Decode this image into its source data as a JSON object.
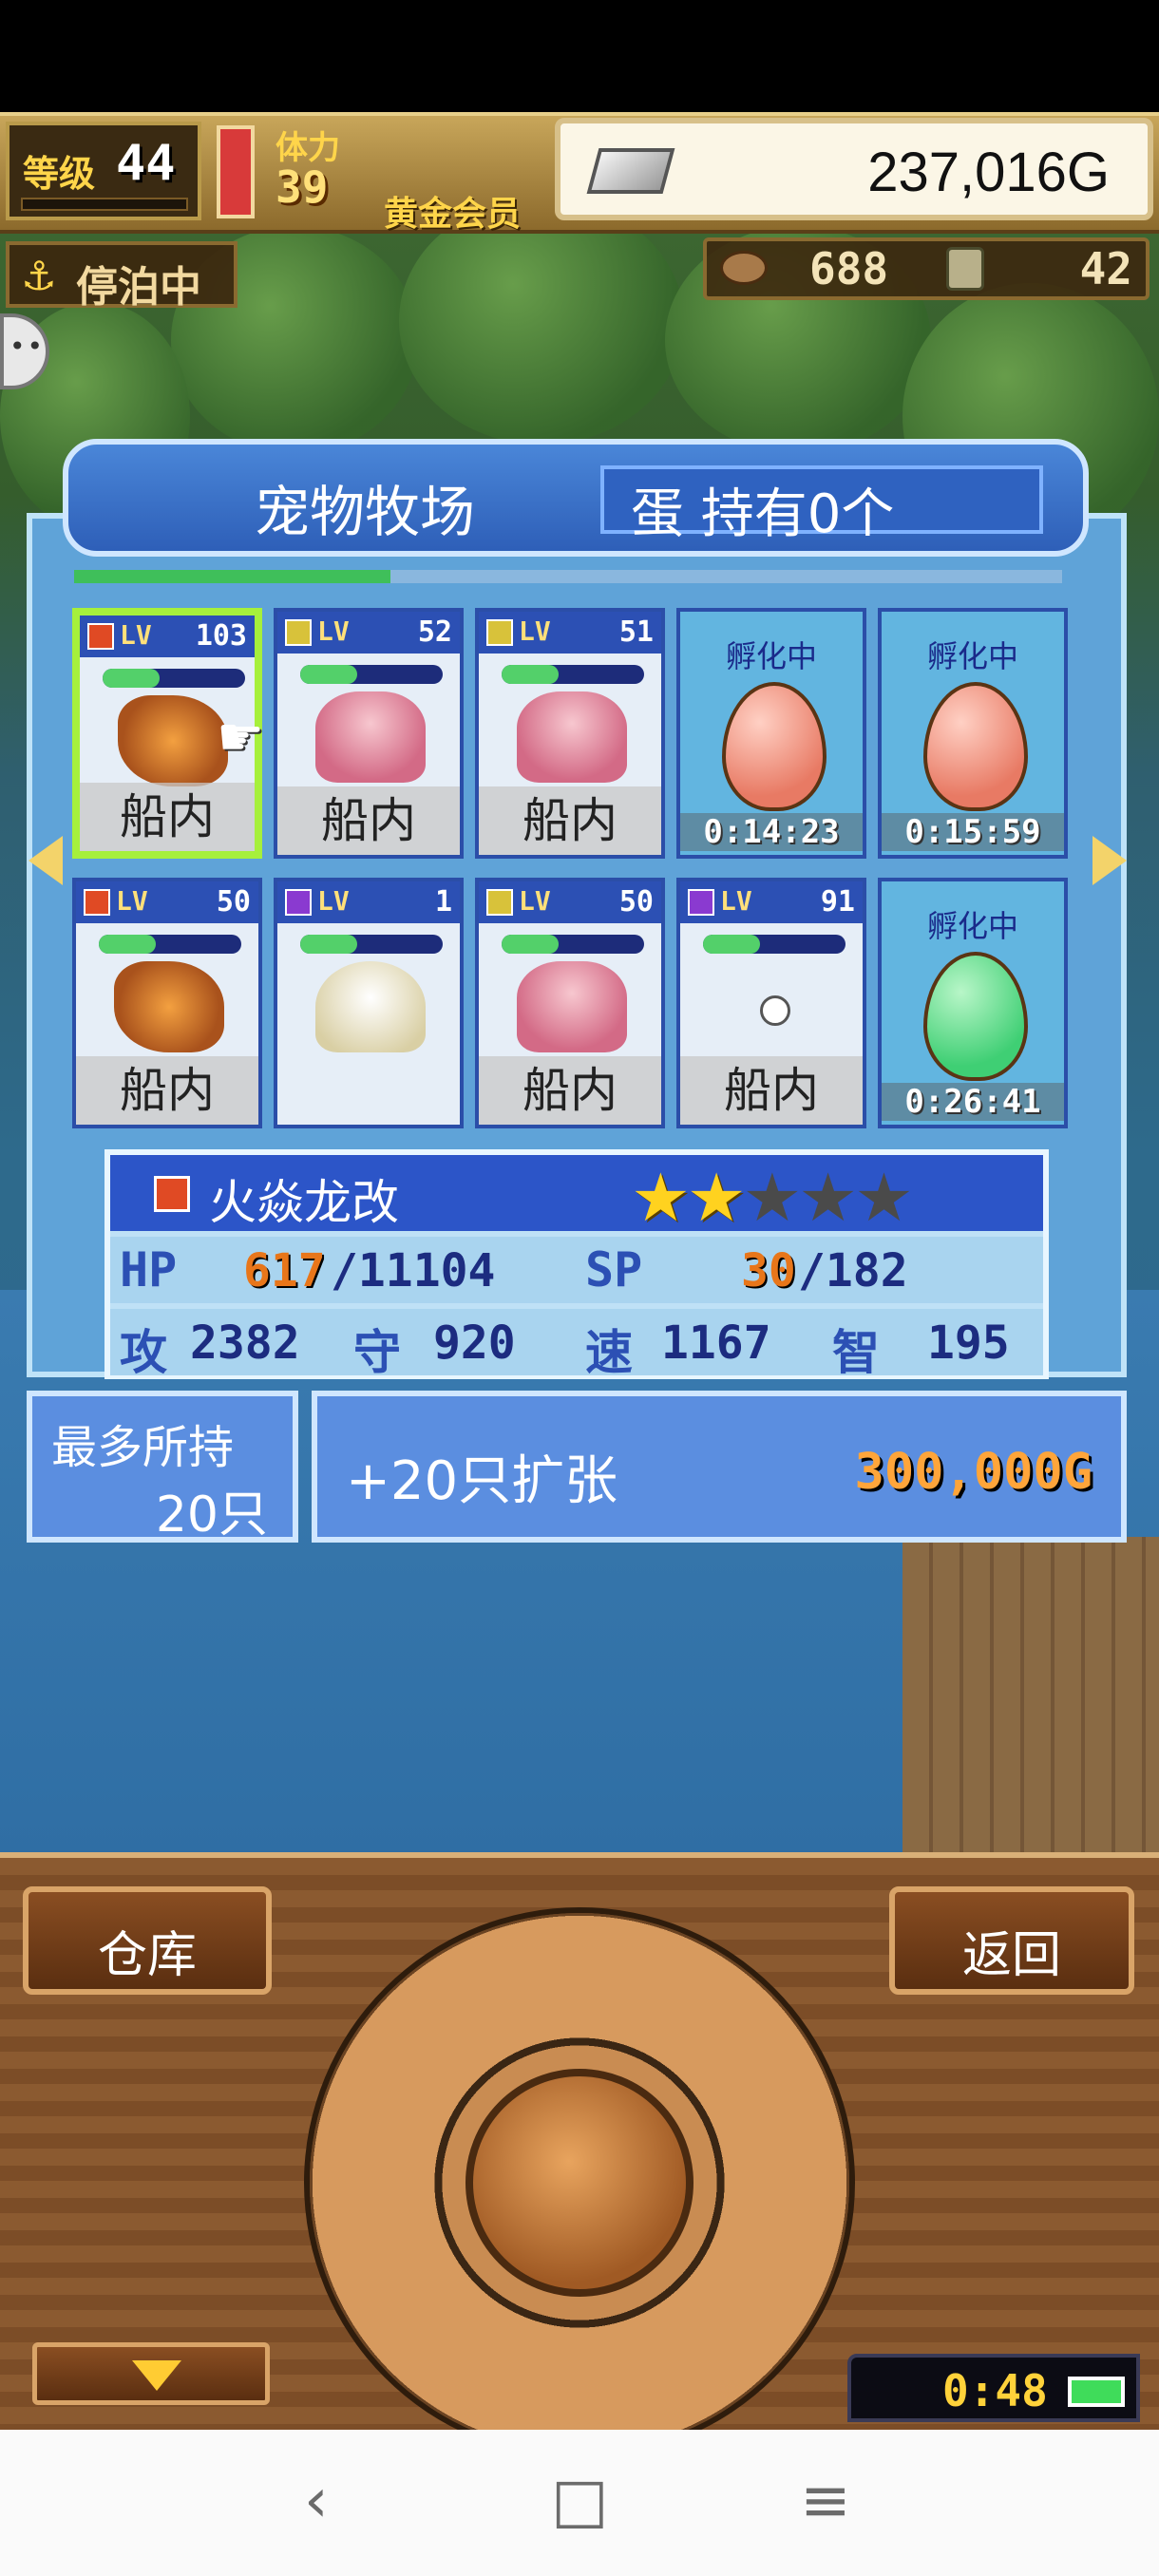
{
  "hud": {
    "level_label": "等级",
    "level_value": "44",
    "stamina_label": "体力",
    "stamina_value": "39",
    "member_label": "黄金会员",
    "gold": "237,016G",
    "status": "停泊中",
    "resource1": "688",
    "resource2": "42"
  },
  "ranch": {
    "title": "宠物牧场",
    "egg_status": "蛋 持有0个",
    "progress": 0.32
  },
  "pets": [
    {
      "element": "fire",
      "lv_label": "LV",
      "lv": "103",
      "sprite": "dragon",
      "location": "船内",
      "selected": true
    },
    {
      "element": "thunder",
      "lv_label": "LV",
      "lv": "52",
      "sprite": "axolotl",
      "location": "船内"
    },
    {
      "element": "thunder",
      "lv_label": "LV",
      "lv": "51",
      "sprite": "axolotl",
      "location": "船内"
    },
    {
      "type": "egg",
      "hatch_label": "孵化中",
      "timer": "0:14:23",
      "color": "pink"
    },
    {
      "type": "egg",
      "hatch_label": "孵化中",
      "timer": "0:15:59",
      "color": "pink"
    },
    {
      "element": "fire",
      "lv_label": "LV",
      "lv": "50",
      "sprite": "dragon",
      "location": "船内"
    },
    {
      "element": "dark",
      "lv_label": "LV",
      "lv": "1",
      "sprite": "ghost",
      "location": ""
    },
    {
      "element": "thunder",
      "lv_label": "LV",
      "lv": "50",
      "sprite": "axolotl",
      "location": "船内"
    },
    {
      "element": "dark",
      "lv_label": "LV",
      "lv": "91",
      "sprite": "tiny",
      "location": "船内"
    },
    {
      "type": "egg",
      "hatch_label": "孵化中",
      "timer": "0:26:41",
      "color": "green"
    }
  ],
  "detail": {
    "name": "火焱龙改",
    "stars_filled": 2,
    "stars_total": 5,
    "hp_label": "HP",
    "hp": "617",
    "hp_max": "/11104",
    "sp_label": "SP",
    "sp": "30",
    "sp_max": "/182",
    "atk_label": "攻",
    "atk": "2382",
    "def_label": "守",
    "def": "920",
    "spd_label": "速",
    "spd": "1167",
    "int_label": "智",
    "int": "195"
  },
  "capacity": {
    "max_label": "最多所持",
    "max_value": "20只",
    "expand_label": "+20只扩张",
    "expand_price": "300,000G"
  },
  "controls": {
    "warehouse": "仓库",
    "back": "返回",
    "clock": "0:48"
  },
  "nav": {
    "back": "‹",
    "home": "□",
    "menu": "≡"
  },
  "colors": {
    "panel_blue": "#5fa3d8",
    "header_blue": "#2e5fb8",
    "selected_border": "#a6f03c",
    "price_orange": "#ffa53a"
  }
}
